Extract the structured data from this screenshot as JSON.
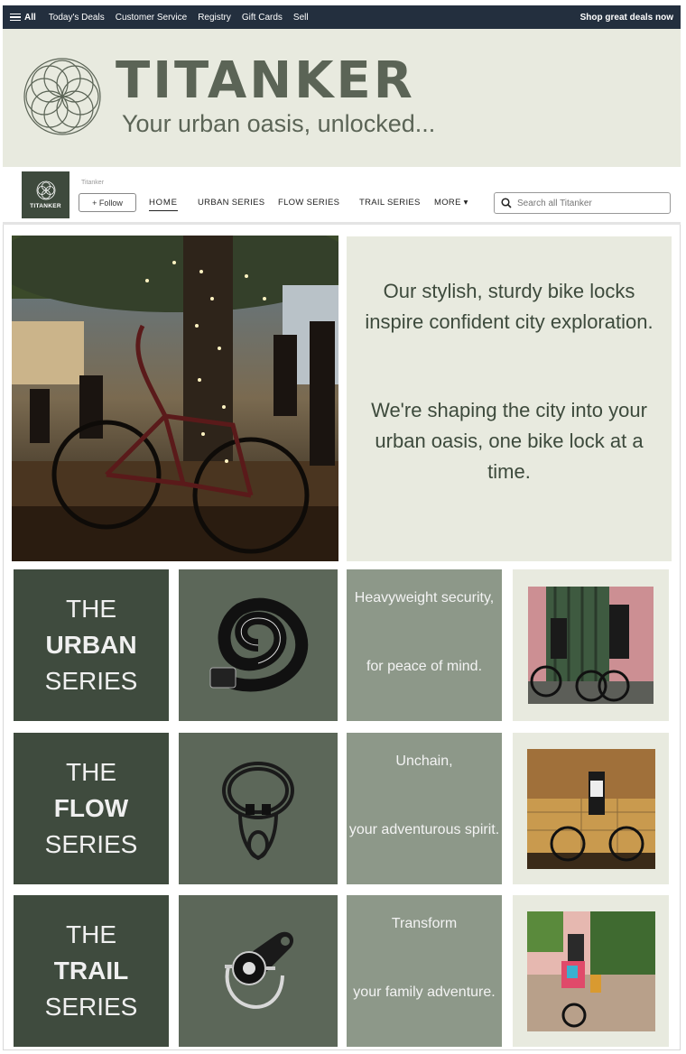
{
  "top_nav": {
    "all_label": "All",
    "links": [
      "Today's Deals",
      "Customer Service",
      "Registry",
      "Gift Cards",
      "Sell"
    ],
    "promo": "Shop great deals now"
  },
  "banner": {
    "brand": "TITANKER",
    "tagline": "Your urban oasis, unlocked..."
  },
  "store_nav": {
    "logo_text": "TITANKER",
    "store_name": "Titanker",
    "follow_label": "+ Follow",
    "items": [
      "HOME",
      "URBAN SERIES",
      "FLOW SERIES",
      "TRAIL SERIES",
      "MORE ▾"
    ],
    "search_placeholder": "Search all Titanker"
  },
  "hero": {
    "text1": "Our stylish, sturdy bike locks inspire confident city exploration.",
    "text2": "We're shaping the city into your urban oasis, one bike lock at a time."
  },
  "series": [
    {
      "the": "THE",
      "name": "URBAN",
      "word": "SERIES",
      "tag1": "Heavyweight security,",
      "tag2": "for peace of mind."
    },
    {
      "the": "THE",
      "name": "FLOW",
      "word": "SERIES",
      "tag1": "Unchain,",
      "tag2": "your adventurous spirit."
    },
    {
      "the": "THE",
      "name": "TRAIL",
      "word": "SERIES",
      "tag1": "Transform",
      "tag2": "your family adventure."
    }
  ],
  "colors": {
    "nav_bg": "#232f3e",
    "brand_sage": "#e8eadf",
    "dark_green": "#3f4b3e",
    "mid_green": "#5c6759",
    "light_green": "#8d9889"
  }
}
